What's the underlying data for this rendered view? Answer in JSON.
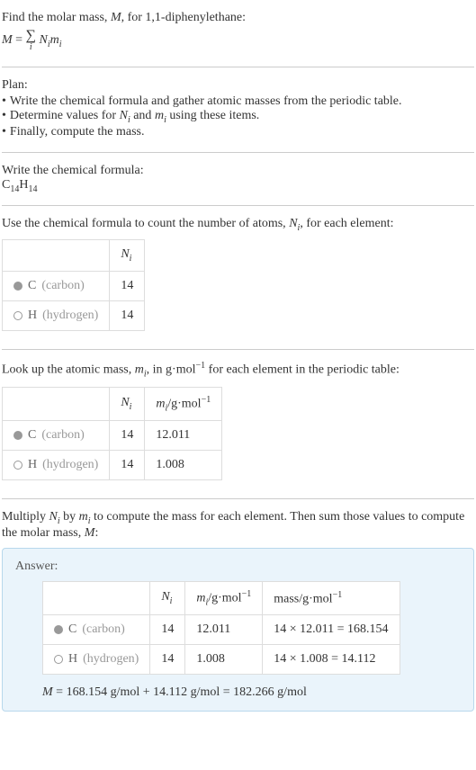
{
  "header": {
    "line1_prefix": "Find the molar mass, ",
    "line1_var": "M",
    "line1_suffix": ", for 1,1-diphenylethane:",
    "formula_lhs": "M",
    "formula_eq": " = ",
    "sigma": "∑",
    "sigma_sub": "i",
    "formula_rhs_n": "N",
    "formula_rhs_n_sub": "i",
    "formula_rhs_m": "m",
    "formula_rhs_m_sub": "i"
  },
  "plan": {
    "title": "Plan:",
    "items": [
      "Write the chemical formula and gather atomic masses from the periodic table.",
      "Determine values for Nᵢ and mᵢ using these items.",
      "Finally, compute the mass."
    ],
    "item2_prefix": "Determine values for ",
    "item2_n": "N",
    "item2_n_sub": "i",
    "item2_and": " and ",
    "item2_m": "m",
    "item2_m_sub": "i",
    "item2_suffix": " using these items."
  },
  "chemical": {
    "title": "Write the chemical formula:",
    "c": "C",
    "c_sub": "14",
    "h": "H",
    "h_sub": "14"
  },
  "count": {
    "title_prefix": "Use the chemical formula to count the number of atoms, ",
    "title_n": "N",
    "title_n_sub": "i",
    "title_suffix": ", for each element:",
    "header_n": "N",
    "header_n_sub": "i",
    "rows": [
      {
        "symbol": "C",
        "name": "(carbon)",
        "n": "14",
        "filled": true
      },
      {
        "symbol": "H",
        "name": "(hydrogen)",
        "n": "14",
        "filled": false
      }
    ]
  },
  "lookup": {
    "title_prefix": "Look up the atomic mass, ",
    "title_m": "m",
    "title_m_sub": "i",
    "title_mid": ", in g·mol",
    "title_sup": "−1",
    "title_suffix": " for each element in the periodic table:",
    "header_n": "N",
    "header_n_sub": "i",
    "header_m": "m",
    "header_m_sub": "i",
    "header_m_unit": "/g·mol",
    "header_m_sup": "−1",
    "rows": [
      {
        "symbol": "C",
        "name": "(carbon)",
        "n": "14",
        "m": "12.011",
        "filled": true
      },
      {
        "symbol": "H",
        "name": "(hydrogen)",
        "n": "14",
        "m": "1.008",
        "filled": false
      }
    ]
  },
  "multiply": {
    "title_prefix": "Multiply ",
    "n": "N",
    "n_sub": "i",
    "mid": " by ",
    "m": "m",
    "m_sub": "i",
    "suffix": " to compute the mass for each element. Then sum those values to compute the molar mass, ",
    "mvar": "M",
    "end": ":"
  },
  "answer": {
    "label": "Answer:",
    "header_n": "N",
    "header_n_sub": "i",
    "header_m": "m",
    "header_m_sub": "i",
    "header_m_unit": "/g·mol",
    "header_m_sup": "−1",
    "header_mass": "mass/g·mol",
    "header_mass_sup": "−1",
    "rows": [
      {
        "symbol": "C",
        "name": "(carbon)",
        "n": "14",
        "m": "12.011",
        "mass": "14 × 12.011 = 168.154",
        "filled": true
      },
      {
        "symbol": "H",
        "name": "(hydrogen)",
        "n": "14",
        "m": "1.008",
        "mass": "14 × 1.008 = 14.112",
        "filled": false
      }
    ],
    "final_m": "M",
    "final_eq": " = 168.154 g/mol + 14.112 g/mol = 182.266 g/mol"
  }
}
